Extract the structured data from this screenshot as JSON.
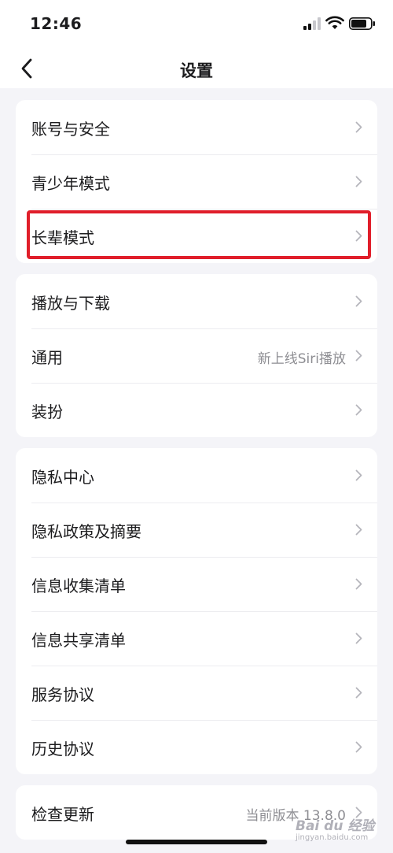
{
  "status_bar": {
    "time": "12:46"
  },
  "nav": {
    "title": "设置",
    "back_icon": "chevron-left-icon"
  },
  "sections": [
    {
      "items": [
        {
          "label": "账号与安全",
          "value": ""
        },
        {
          "label": "青少年模式",
          "value": ""
        },
        {
          "label": "长辈模式",
          "value": ""
        }
      ]
    },
    {
      "items": [
        {
          "label": "播放与下载",
          "value": ""
        },
        {
          "label": "通用",
          "value": "新上线Siri播放"
        },
        {
          "label": "装扮",
          "value": ""
        }
      ]
    },
    {
      "items": [
        {
          "label": "隐私中心",
          "value": ""
        },
        {
          "label": "隐私政策及摘要",
          "value": ""
        },
        {
          "label": "信息收集清单",
          "value": ""
        },
        {
          "label": "信息共享清单",
          "value": ""
        },
        {
          "label": "服务协议",
          "value": ""
        },
        {
          "label": "历史协议",
          "value": ""
        }
      ]
    },
    {
      "items": [
        {
          "label": "检查更新",
          "value": "当前版本 13.8.0"
        }
      ]
    }
  ],
  "annotation": {
    "highlight_color": "#e01e2a"
  },
  "watermark": {
    "text": "Bai du 经验",
    "sub": "jingyan.baidu.com"
  }
}
